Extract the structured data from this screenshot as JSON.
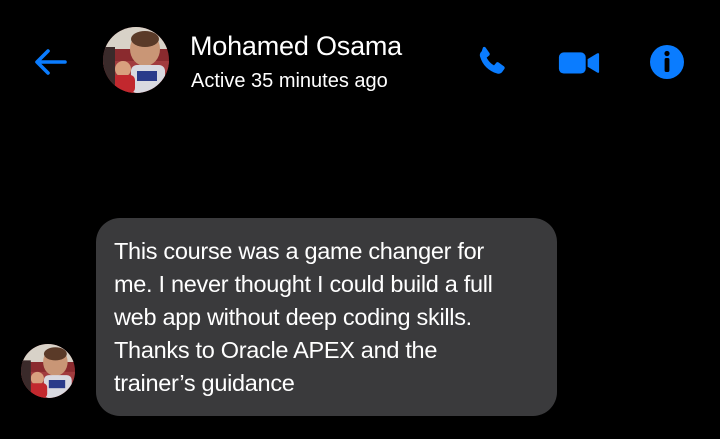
{
  "colors": {
    "background": "#000000",
    "accent": "#0a7cff",
    "bubble": "#3a3a3c",
    "text": "#ffffff"
  },
  "header": {
    "back_icon": "back-arrow-icon",
    "contact_name": "Mohamed Osama",
    "status": "Active 35 minutes ago",
    "actions": [
      {
        "icon": "phone-icon"
      },
      {
        "icon": "video-camera-icon"
      },
      {
        "icon": "info-icon"
      }
    ]
  },
  "messages": [
    {
      "sender": "contact",
      "lines": [
        "This course was a game changer for",
        "me. I never thought I could build a full",
        "web app without deep coding skills.",
        "Thanks to Oracle APEX and the",
        "trainer’s guidance"
      ]
    }
  ]
}
